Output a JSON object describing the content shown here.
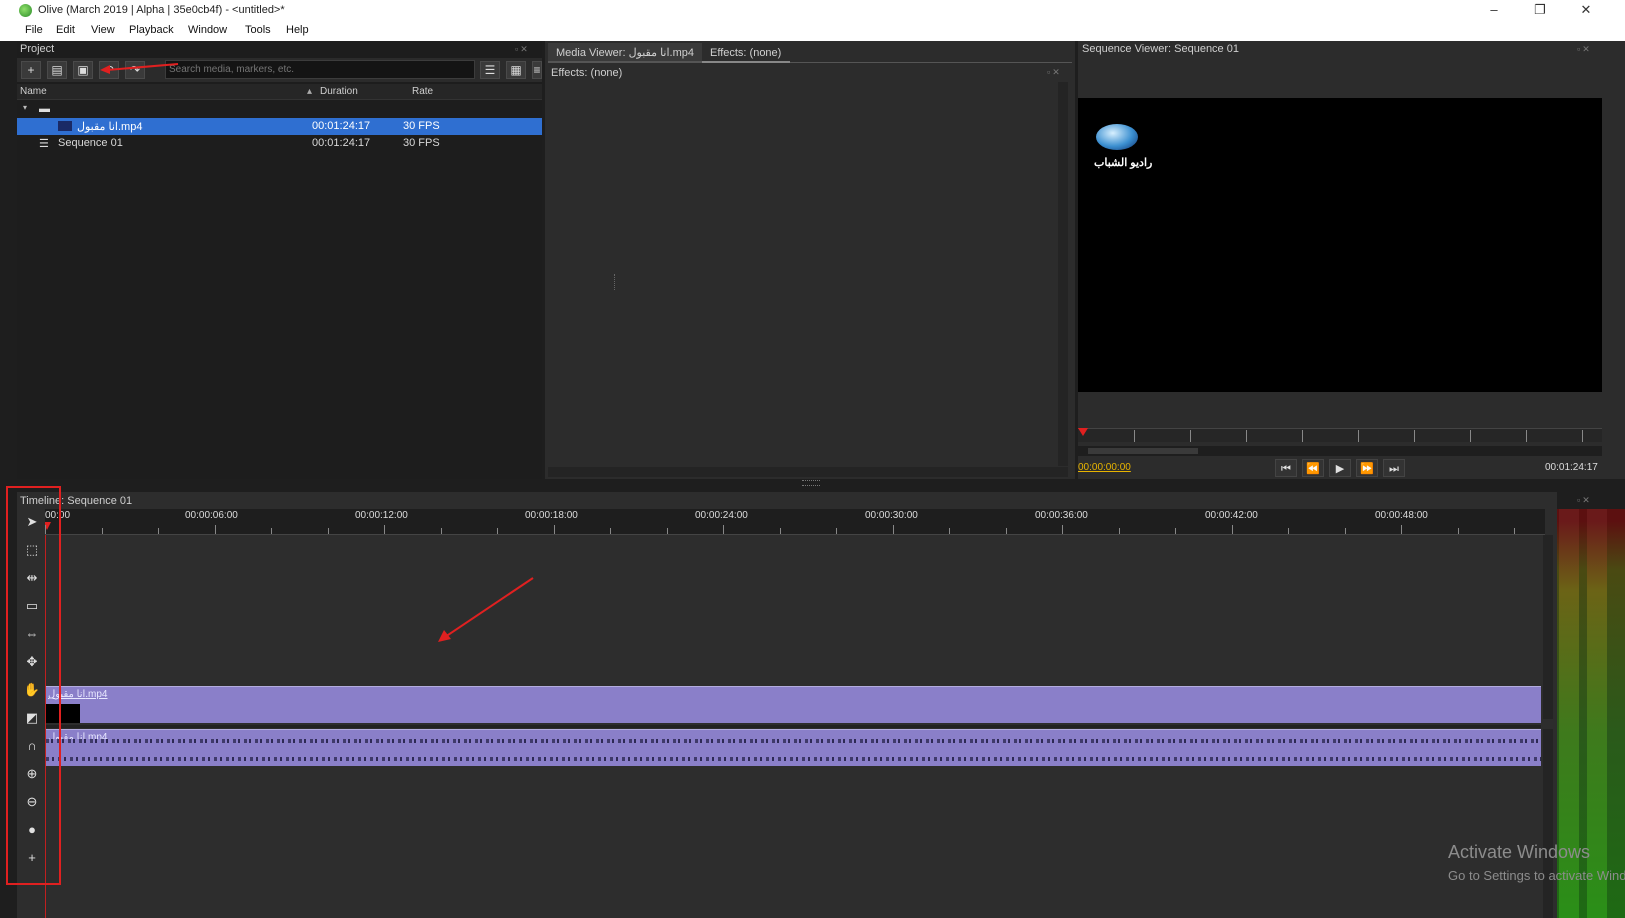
{
  "window": {
    "title": "Olive (March 2019 | Alpha | 35e0cb4f) - <untitled>*",
    "controls": {
      "minimize": "–",
      "maximize": "❐",
      "close": "✕"
    }
  },
  "menu": [
    "File",
    "Edit",
    "View",
    "Playback",
    "Window",
    "Tools",
    "Help"
  ],
  "project": {
    "title": "Project",
    "search_placeholder": "Search media, markers, etc.",
    "columns": {
      "name": "Name",
      "duration": "Duration",
      "rate": "Rate"
    },
    "items": [
      {
        "name": "انا مقبول.mp4",
        "duration": "00:01:24:17",
        "rate": "30 FPS"
      },
      {
        "name": "Sequence 01",
        "duration": "00:01:24:17",
        "rate": "30 FPS"
      }
    ]
  },
  "tabs": {
    "media_viewer": "Media Viewer: انا مقبول.mp4",
    "effects": "Effects: (none)"
  },
  "effects_panel": {
    "header": "Effects: (none)"
  },
  "sequence_viewer": {
    "title": "Sequence Viewer: Sequence 01",
    "logo_text": "راديو الشباب",
    "current_time": "00:00:00:00",
    "end_time": "00:01:24:17"
  },
  "timeline": {
    "title": "Timeline: Sequence 01",
    "ticks": [
      "00:00",
      "00:00:06:00",
      "00:00:12:00",
      "00:00:18:00",
      "00:00:24:00",
      "00:00:30:00",
      "00:00:36:00",
      "00:00:42:00",
      "00:00:48:00"
    ],
    "video_clip": "انا مقبول.mp4",
    "audio_clip": "انا مقبول.mp4"
  },
  "watermark": {
    "line1": "Activate Windows",
    "line2": "Go to Settings to activate Windows."
  },
  "colors": {
    "selection": "#2f6fd1",
    "clip": "#8a7fc9",
    "annotation": "#e02020",
    "timecode": "#e8b400"
  }
}
